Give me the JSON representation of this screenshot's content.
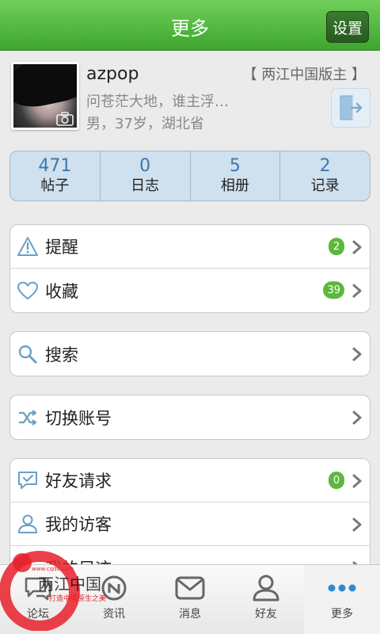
{
  "header": {
    "title": "更多",
    "settings_label": "设置"
  },
  "profile": {
    "username": "azpop",
    "signature": "问苍茫大地，谁主浮…",
    "meta": "男，37岁，湖北省",
    "role": "【 两江中国版主 】"
  },
  "stats": [
    {
      "value": "471",
      "label": "帖子"
    },
    {
      "value": "0",
      "label": "日志"
    },
    {
      "value": "5",
      "label": "相册"
    },
    {
      "value": "2",
      "label": "记录"
    }
  ],
  "groups": {
    "g1": [
      {
        "label": "提醒",
        "icon": "warning-icon",
        "badge": "2"
      },
      {
        "label": "收藏",
        "icon": "heart-icon",
        "badge": "39"
      }
    ],
    "g2": [
      {
        "label": "搜索",
        "icon": "search-icon"
      }
    ],
    "g3": [
      {
        "label": "切换账号",
        "icon": "shuffle-icon"
      }
    ],
    "g4": [
      {
        "label": "好友请求",
        "icon": "chat-check-icon",
        "badge": "0"
      },
      {
        "label": "我的访客",
        "icon": "person-icon"
      },
      {
        "label": "我的足迹",
        "icon": "footprint-icon"
      }
    ]
  },
  "tabs": [
    {
      "label": "论坛",
      "icon": "forum-icon"
    },
    {
      "label": "资讯",
      "icon": "news-icon"
    },
    {
      "label": "消息",
      "icon": "mail-icon"
    },
    {
      "label": "好友",
      "icon": "friends-icon"
    },
    {
      "label": "更多",
      "icon": "more-dots-icon",
      "active": true
    }
  ],
  "watermark": {
    "text": "两江中国",
    "sub": "www.cqdd.com",
    "tagline": "打造中国原生之美"
  },
  "colors": {
    "accent_green": "#4cb83a",
    "stat_blue": "#3c78b0",
    "badge_green": "#5cb83a"
  }
}
